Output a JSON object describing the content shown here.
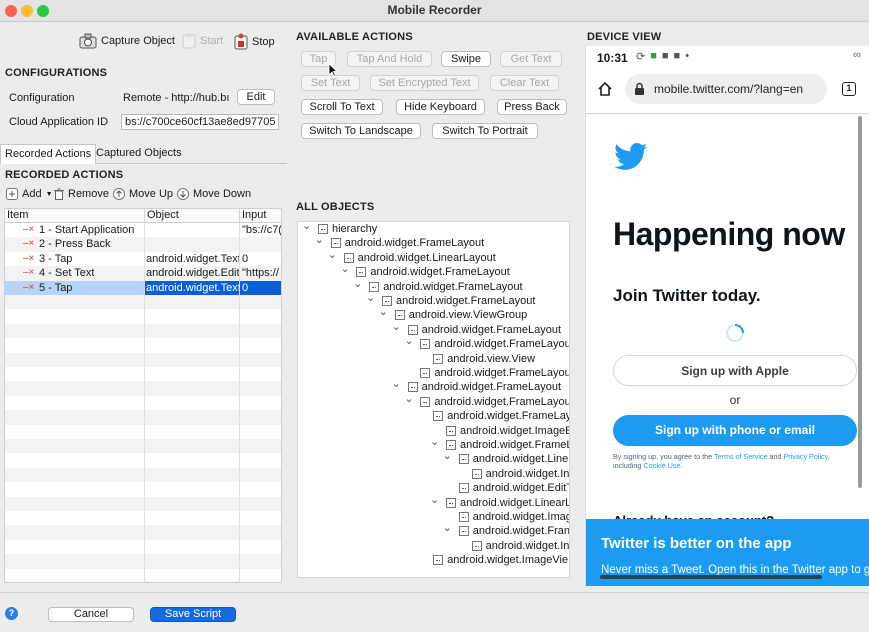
{
  "window": {
    "title": "Mobile Recorder"
  },
  "toolbar": {
    "capture": "Capture Object",
    "start": "Start",
    "stop": "Stop"
  },
  "config": {
    "section": "CONFIGURATIONS",
    "config_label": "Configuration",
    "config_value": "Remote - http://hub.bı",
    "edit": "Edit",
    "cloud_label": "Cloud Application ID",
    "cloud_value": "bs://c700ce60cf13ae8ed97705"
  },
  "tabs": {
    "recorded": "Recorded Actions",
    "captured": "Captured Objects"
  },
  "recorded": {
    "section": "RECORDED ACTIONS",
    "add": "Add",
    "remove": "Remove",
    "move_up": "Move Up",
    "move_down": "Move Down",
    "columns": [
      "Item",
      "Object",
      "Input"
    ],
    "rows": [
      {
        "item": "1 - Start Application",
        "object": "",
        "input": "\"bs://c7("
      },
      {
        "item": "2 - Press Back",
        "object": "",
        "input": ""
      },
      {
        "item": "3 - Tap",
        "object": "android.widget.Text",
        "input": "0"
      },
      {
        "item": "4 - Set Text",
        "object": "android.widget.Edit",
        "input": "\"https://"
      },
      {
        "item": "5 - Tap",
        "object": "android.widget.Text",
        "input": "0"
      }
    ]
  },
  "actions": {
    "section": "AVAILABLE ACTIONS",
    "tap": "Tap",
    "tap_hold": "Tap And Hold",
    "swipe": "Swipe",
    "get_text": "Get Text",
    "set_text": "Set Text",
    "set_enc": "Set Encrypted Text",
    "clear_text": "Clear Text",
    "scroll": "Scroll To Text",
    "hide_kb": "Hide Keyboard",
    "press_back": "Press Back",
    "landscape": "Switch To Landscape",
    "portrait": "Switch To Portrait"
  },
  "objects": {
    "section": "ALL OBJECTS",
    "nodes": [
      "hierarchy",
      "android.widget.FrameLayout",
      "android.widget.LinearLayout",
      "android.widget.FrameLayout",
      "android.widget.FrameLayout",
      "android.widget.FrameLayout",
      "android.view.ViewGroup",
      "android.widget.FrameLayout",
      "android.widget.FrameLayou",
      "android.view.View",
      "android.widget.FrameLayou",
      "android.widget.FrameLayout",
      "android.widget.FrameLayou",
      "android.widget.FrameLay",
      "android.widget.ImageE",
      "android.widget.FrameL",
      "android.widget.Line",
      "android.widget.In",
      "android.widget.EditT",
      "android.widget.LinearL",
      "android.widget.Imag",
      "android.widget.Fran",
      "android.widget.In",
      "android.widget.ImageVie"
    ]
  },
  "device": {
    "section": "DEVICE VIEW",
    "time": "10:31",
    "url": "mobile.twitter.com/?lang=en",
    "tabs_count": "1",
    "headline": "Happening now",
    "join": "Join Twitter today.",
    "apple": "Sign up with Apple",
    "or": "or",
    "phone": "Sign up with phone or email",
    "terms_pre": "By signing up, you agree to the ",
    "terms": "Terms of Service",
    "terms_and": " and ",
    "privacy": "Privacy Policy",
    "terms_post": ",",
    "including": "including ",
    "cookie": "Cookie Use",
    "partial": "Already have an account?",
    "banner_title": "Twitter is better on the app",
    "banner_sub": "Never miss a Tweet. Open this in the Twitter app to get the full experience."
  },
  "footer": {
    "help": "?",
    "cancel": "Cancel",
    "save": "Save Script"
  },
  "colors": {
    "twitter_blue": "#1d9bf0",
    "selection": "#0a5fd6",
    "remove_red": "#c6423b"
  }
}
